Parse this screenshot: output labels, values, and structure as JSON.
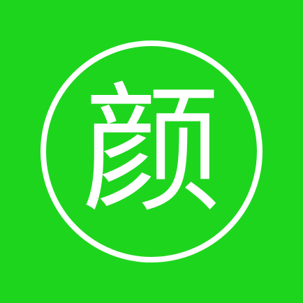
{
  "app_icon": {
    "character": "颜",
    "background_color": "#1ed51e",
    "foreground_color": "#ffffff"
  }
}
